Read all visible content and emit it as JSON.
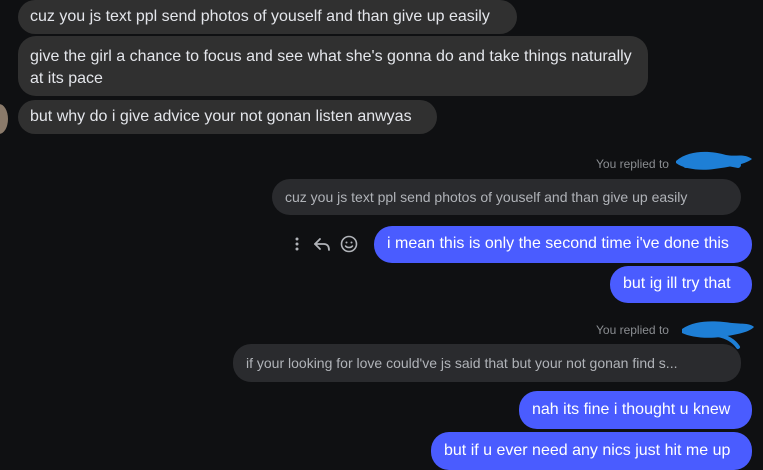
{
  "incoming": [
    {
      "text": "cuz you js text ppl send photos of youself and than give up easily"
    },
    {
      "text": "give the girl a chance to focus and see what she's gonna do and take things naturally at its pace"
    },
    {
      "text": "but why do i give advice your not gonan listen anwyas"
    }
  ],
  "reply_block_1": {
    "label": "You replied to",
    "quoted": "cuz you js text ppl send photos of youself and than give up easily"
  },
  "outgoing_1": [
    {
      "text": "i mean this is only the second time i've done this"
    },
    {
      "text": "but ig ill try that"
    }
  ],
  "reply_block_2": {
    "label": "You replied to",
    "quoted": "if your looking for love could've js said that but your not gonan find s..."
  },
  "outgoing_2": [
    {
      "text": "nah its fine i thought u knew"
    },
    {
      "text": "but if u ever need any nics just hit me up"
    }
  ],
  "actions": {
    "more": "more-icon",
    "reply": "reply-icon",
    "react": "smiley-icon"
  },
  "colors": {
    "background": "#0f1012",
    "incoming_bubble": "#303030",
    "outgoing_bubble": "#4a5cff",
    "quoted_bubble": "#2a2b2e",
    "redaction": "#1e7fd6"
  }
}
